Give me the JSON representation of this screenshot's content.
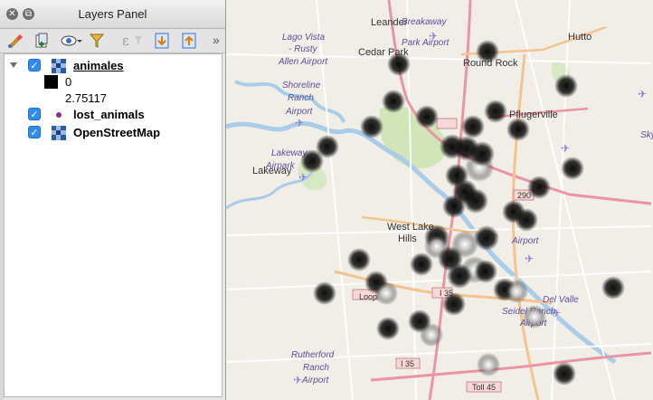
{
  "panel": {
    "title": "Layers Panel",
    "overflow_glyph": "»",
    "toolbar_icons": [
      "open-layer-styling-icon",
      "add-group-icon",
      "manage-visibility-icon",
      "filter-legend-icon",
      "filter-expression-icon",
      "expand-all-icon",
      "collapse-all-icon"
    ]
  },
  "layers": [
    {
      "name": "animales",
      "checked": true,
      "expanded": true,
      "icon": "raster-layer-icon",
      "legend": [
        {
          "label": "0",
          "color": "#000000"
        },
        {
          "label": "2.75117",
          "color": "#ffffff"
        }
      ]
    },
    {
      "name": "lost_animals",
      "checked": true,
      "icon": "point-symbol-icon",
      "symbol_color": "#8e2a8e"
    },
    {
      "name": "OpenStreetMap",
      "checked": true,
      "icon": "raster-layer-icon"
    }
  ],
  "map": {
    "labels": [
      {
        "text": "Leander",
        "kind": "town"
      },
      {
        "text": "Breakaway",
        "kind": "place"
      },
      {
        "text": "Park Airport",
        "kind": "place"
      },
      {
        "text": "Hutto",
        "kind": "town"
      },
      {
        "text": "Lago Vista",
        "kind": "place"
      },
      {
        "text": "- Rusty",
        "kind": "place"
      },
      {
        "text": "Allen Airport",
        "kind": "place"
      },
      {
        "text": "Cedar Park",
        "kind": "town"
      },
      {
        "text": "Round Rock",
        "kind": "town"
      },
      {
        "text": "Shoreline",
        "kind": "place"
      },
      {
        "text": "Ranch",
        "kind": "place"
      },
      {
        "text": "Airport",
        "kind": "place"
      },
      {
        "text": "Pflugerville",
        "kind": "town"
      },
      {
        "text": "Skye",
        "kind": "place"
      },
      {
        "text": "Lakeway",
        "kind": "place"
      },
      {
        "text": "Airpark",
        "kind": "place"
      },
      {
        "text": "Lakeway",
        "kind": "town"
      },
      {
        "text": "West Lake",
        "kind": "town"
      },
      {
        "text": "Hills",
        "kind": "town"
      },
      {
        "text": "Airport",
        "kind": "place"
      },
      {
        "text": "Del Valle",
        "kind": "place"
      },
      {
        "text": "Seidel Ranch",
        "kind": "place"
      },
      {
        "text": "Airport",
        "kind": "place"
      },
      {
        "text": "Rutherford",
        "kind": "place"
      },
      {
        "text": "Ranch",
        "kind": "place"
      },
      {
        "text": "Airport",
        "kind": "place"
      },
      {
        "text": "I 35",
        "kind": "shield"
      },
      {
        "text": "Toll 45",
        "kind": "shield"
      },
      {
        "text": "I 35",
        "kind": "shield"
      },
      {
        "text": "290",
        "kind": "shield"
      },
      {
        "text": "Loop",
        "kind": "shield"
      }
    ],
    "heat_hotspots": 38
  }
}
